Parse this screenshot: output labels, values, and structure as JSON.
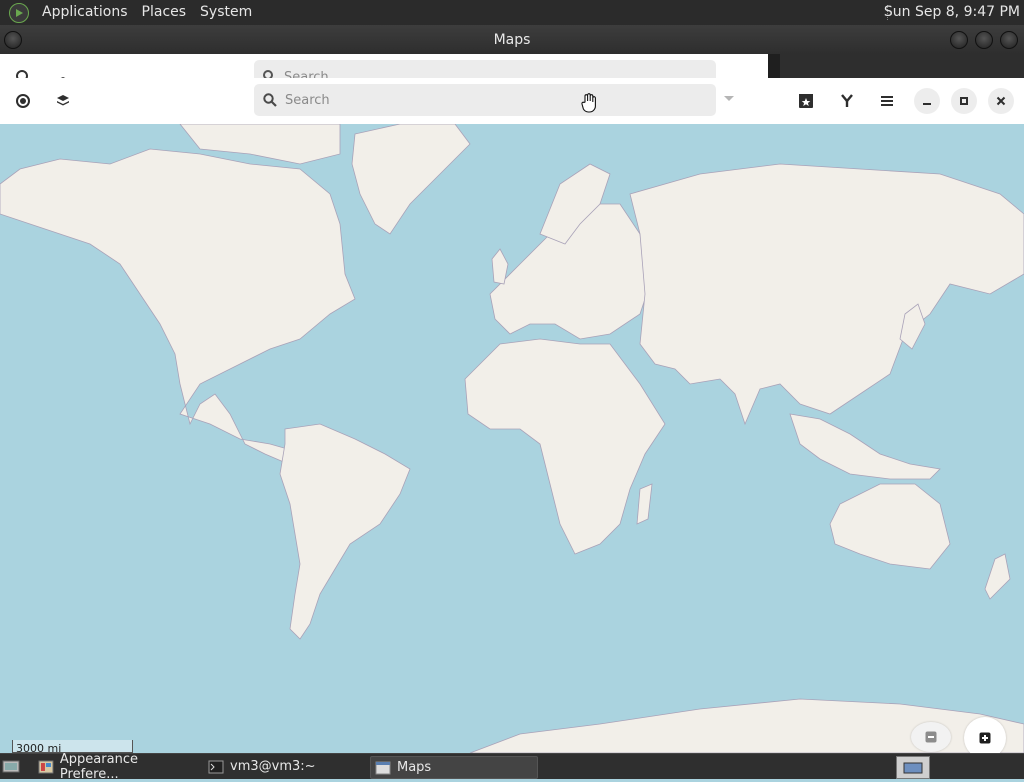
{
  "top_panel": {
    "menus": [
      "Applications",
      "Places",
      "System"
    ],
    "clock": "Sun Sep  8,  9:47 PM"
  },
  "window": {
    "title": "Maps"
  },
  "header": {
    "search": {
      "placeholder": "Search",
      "value": ""
    },
    "ghost_search_placeholder": "Search"
  },
  "map": {
    "scale_label": "3000 mi"
  },
  "taskbar": {
    "items": [
      {
        "label": "Appearance Prefere...",
        "active": false
      },
      {
        "label": "vm3@vm3:~",
        "active": false
      },
      {
        "label": "Maps",
        "active": true
      }
    ]
  },
  "colors": {
    "water": "#aad3df",
    "land": "#f2efe9",
    "border": "#a9a2b8"
  }
}
